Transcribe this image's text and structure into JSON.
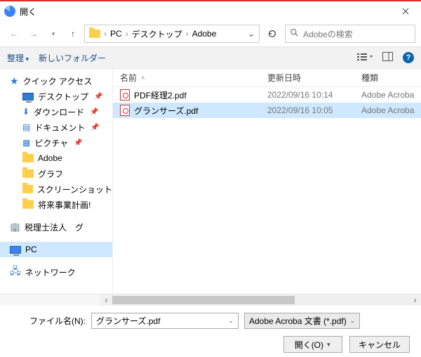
{
  "title": "開く",
  "breadcrumb": {
    "root": "PC",
    "items": [
      "デスクトップ",
      "Adobe"
    ]
  },
  "search": {
    "placeholder": "Adobeの検索"
  },
  "toolbar": {
    "organize": "整理",
    "newfolder": "新しいフォルダー"
  },
  "columns": {
    "name": "名前",
    "date": "更新日時",
    "type": "種類"
  },
  "tree": {
    "quick": "クイック アクセス",
    "desktop": "デスクトップ",
    "downloads": "ダウンロード",
    "documents": "ドキュメント",
    "pictures": "ピクチャ",
    "adobe": "Adobe",
    "graph": "グラフ",
    "screenshot": "スクリーンショット",
    "shorai": "将来事業計画!",
    "zeirishi": "税理士法人　グ",
    "pc": "PC",
    "network": "ネットワーク"
  },
  "files": [
    {
      "name": "PDF経理2.pdf",
      "date": "2022/09/16 10:14",
      "type": "Adobe Acroba"
    },
    {
      "name": "グランサーズ.pdf",
      "date": "2022/09/16 10:05",
      "type": "Adobe Acroba"
    }
  ],
  "filename_label": "ファイル名(N):",
  "filename_value": "グランサーズ.pdf",
  "filetype_value": "Adobe Acroba 文書 (*.pdf)",
  "buttons": {
    "open": "開く(O)",
    "cancel": "キャンセル"
  }
}
